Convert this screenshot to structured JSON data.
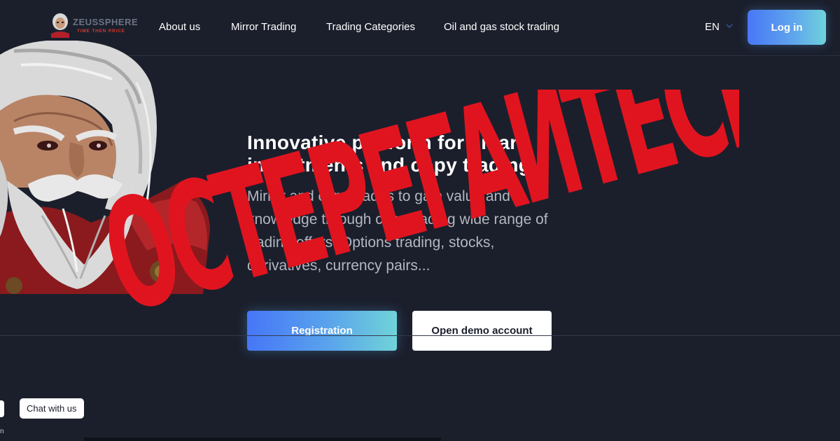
{
  "header": {
    "logo_name": "ZEUSSPHERE",
    "logo_tagline": "TIME THEN PRICE",
    "nav": [
      {
        "label": "About us"
      },
      {
        "label": "Mirror Trading"
      },
      {
        "label": "Trading Categories"
      },
      {
        "label": "Oil and gas stock trading"
      }
    ],
    "language": "EN",
    "login_label": "Log in"
  },
  "hero": {
    "title": "Innovative platform for smart investments and copy trading",
    "description": "Mirror and copy trades to gain value and knowledge through copy trading wide range of trading offers. Options trading, stocks, derivatives, currency pairs...",
    "register_label": "Registration",
    "demo_label": "Open demo account"
  },
  "overlay": {
    "warning_text": "ОСТЕРЕГАЙТЕСЬ!",
    "color": "#e0141f"
  },
  "chat": {
    "label": "Chat with us",
    "fragment": "n"
  },
  "icons": {
    "logo": "zeus-head-logo-icon",
    "language_chevron": "chevron-down-icon"
  },
  "colors": {
    "background": "#1b1f2c",
    "accent_gradient_start": "#4676f7",
    "accent_gradient_end": "#70d3d8",
    "muted_text": "#b3b7c0"
  }
}
